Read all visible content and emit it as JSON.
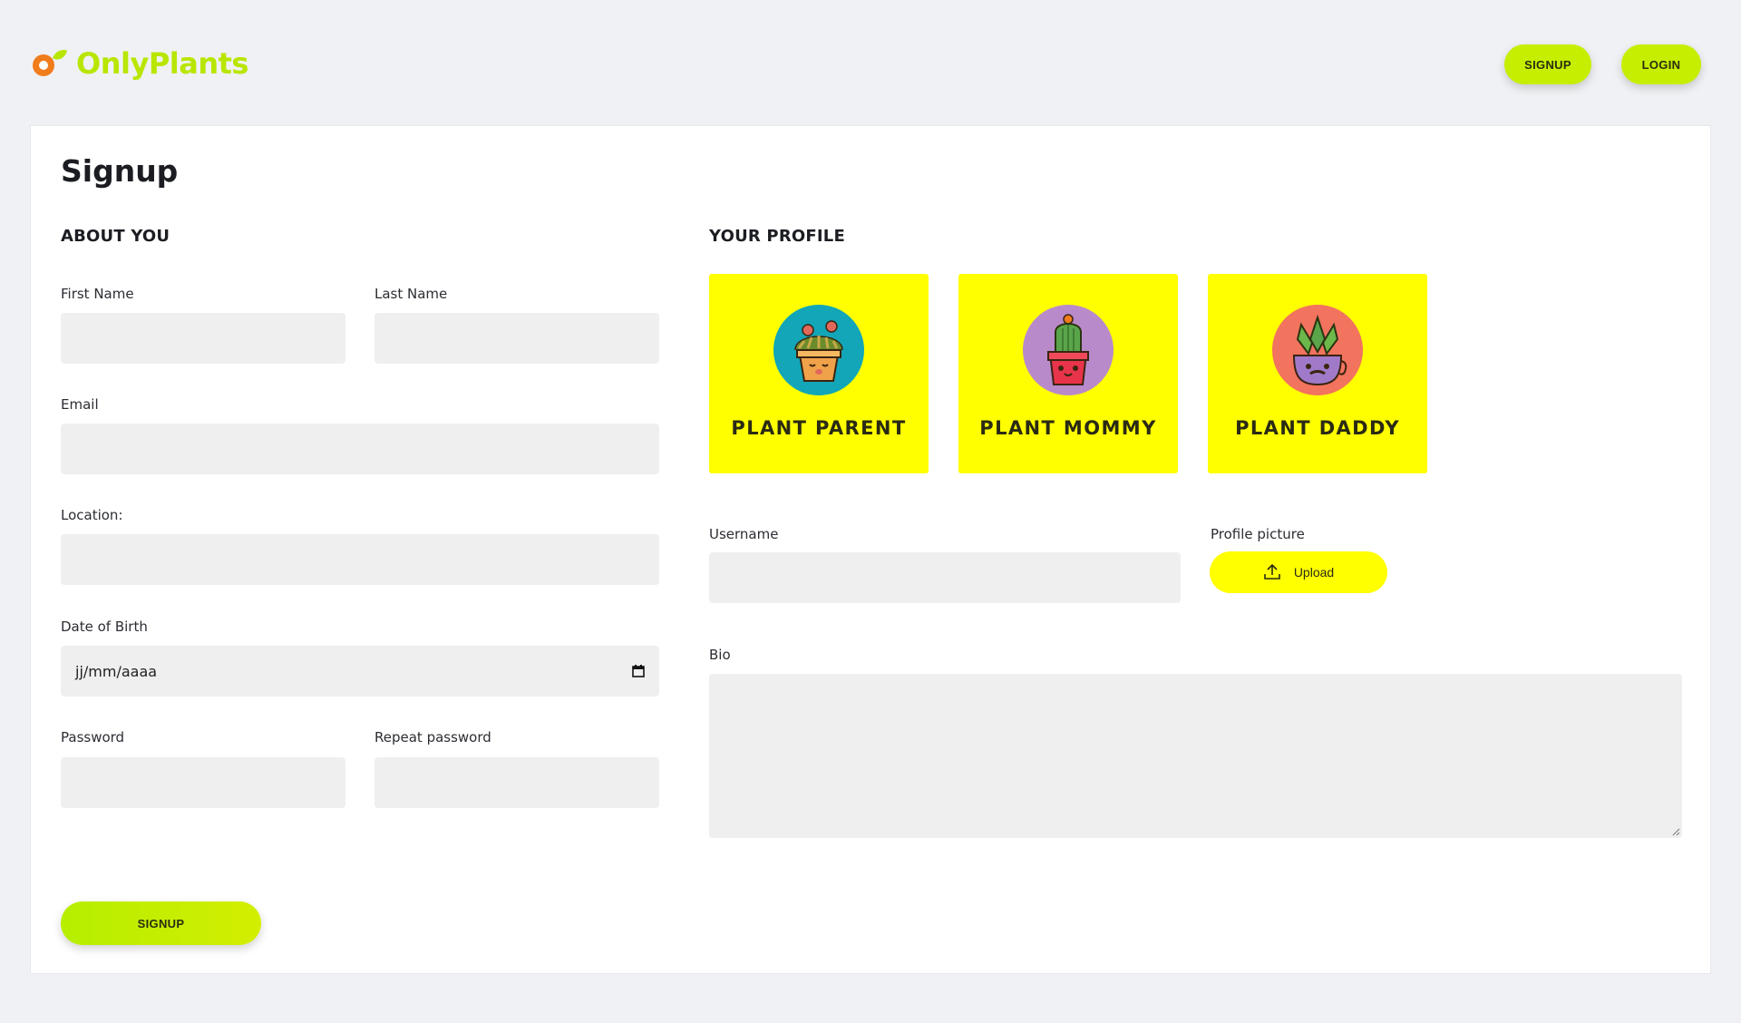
{
  "brand": {
    "name": "OnlyPlants",
    "color": "#b8e600",
    "mark_color": "#f07c1b"
  },
  "nav": {
    "signup_label": "SIGNUP",
    "login_label": "LOGIN",
    "accent": "#c6ee00"
  },
  "form": {
    "title": "Signup",
    "about": {
      "section_title": "ABOUT YOU",
      "first_name_label": "First Name",
      "last_name_label": "Last Name",
      "email_label": "Email",
      "location_label": "Location:",
      "dob_label": "Date of Birth",
      "dob_placeholder": "jj/mm/aaaa",
      "password_label": "Password",
      "repeat_password_label": "Repeat password"
    },
    "profile": {
      "section_title": "YOUR PROFILE",
      "types": [
        {
          "label": "PLANT PARENT",
          "icon": "plant-parent-icon",
          "bg": "#12a6b8"
        },
        {
          "label": "PLANT MOMMY",
          "icon": "plant-mommy-icon",
          "bg": "#b98ac9"
        },
        {
          "label": "PLANT DADDY",
          "icon": "plant-daddy-icon",
          "bg": "#f2735e"
        }
      ],
      "card_color": "#ffff00",
      "username_label": "Username",
      "picture_label": "Profile picture",
      "upload_label": "Upload",
      "bio_label": "Bio"
    },
    "submit_label": "SIGNUP"
  }
}
